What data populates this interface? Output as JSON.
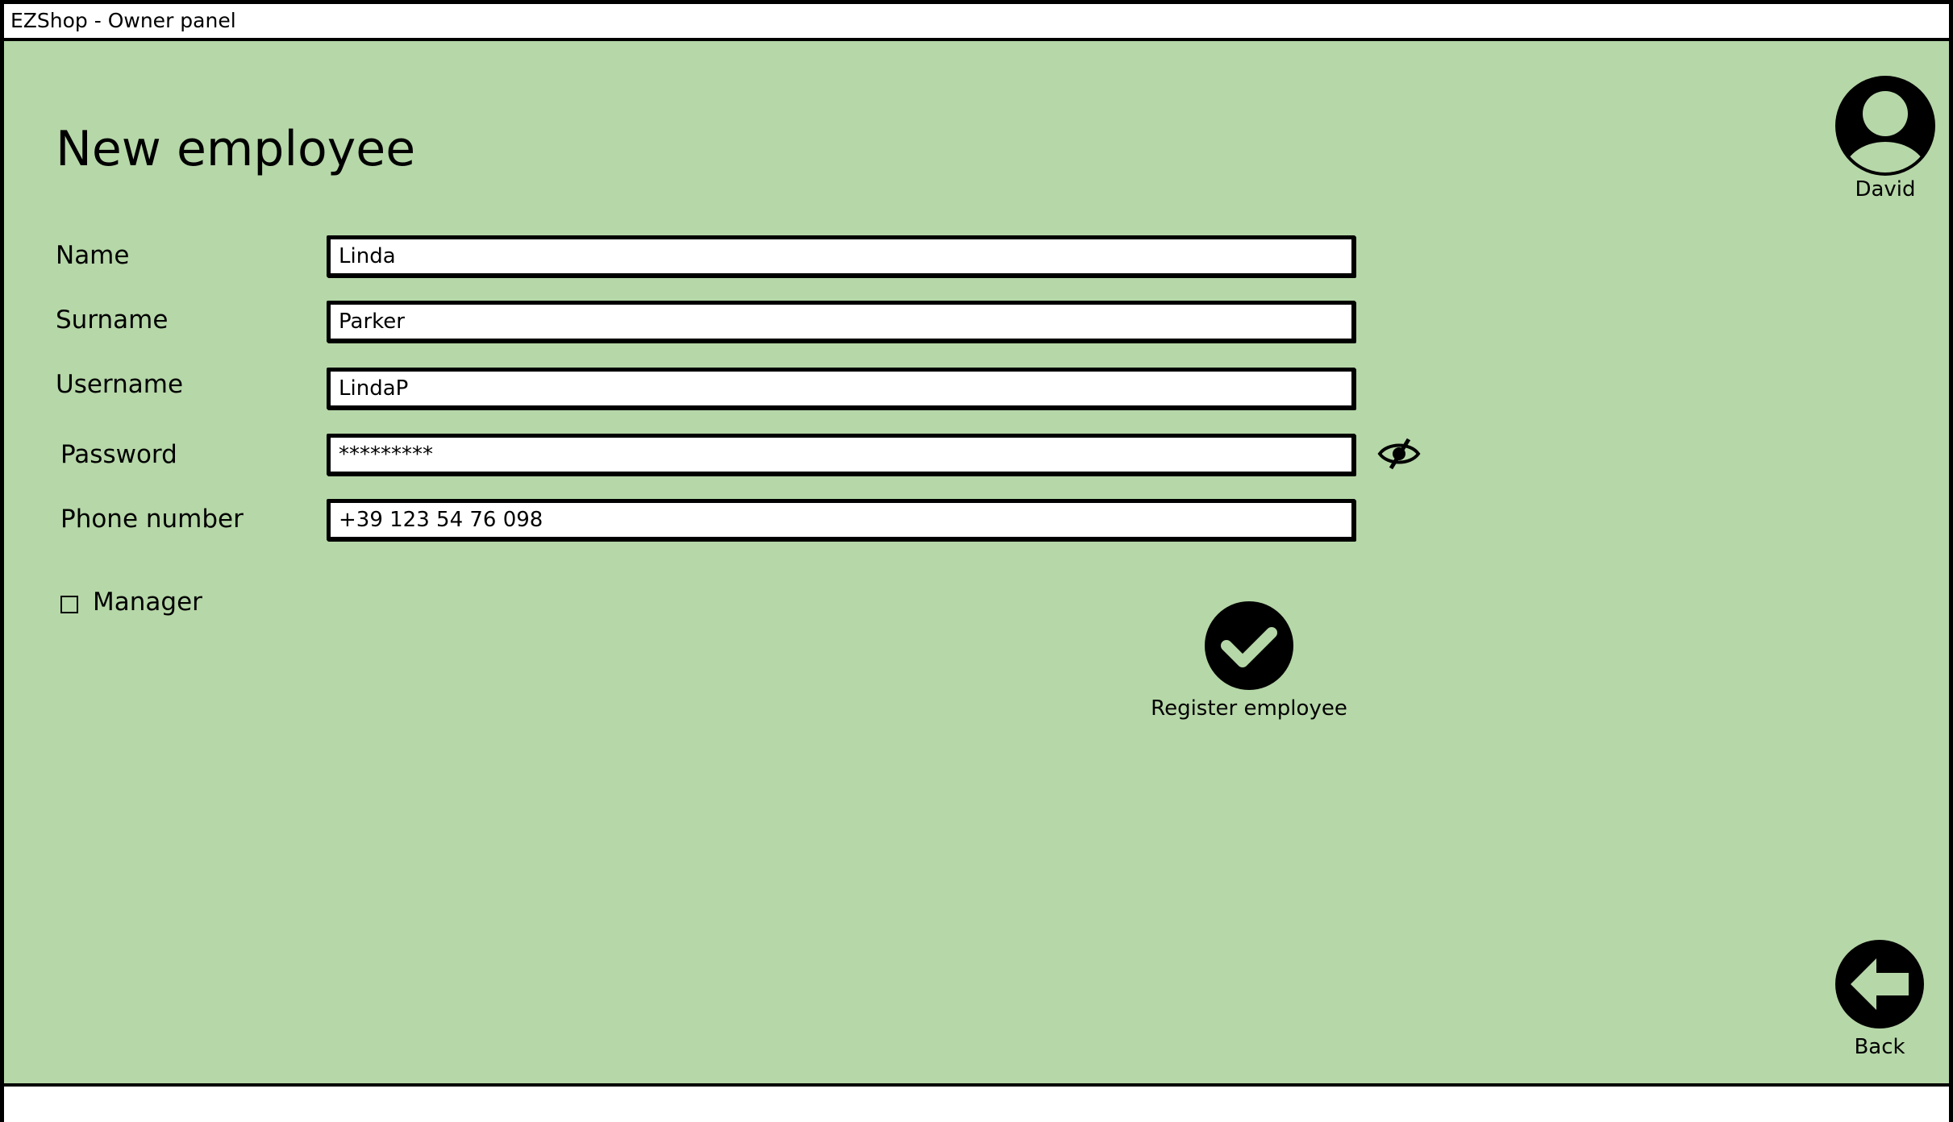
{
  "window": {
    "title": "EZShop - Owner panel"
  },
  "page": {
    "title": "New employee"
  },
  "user": {
    "name": "David"
  },
  "form": {
    "name": {
      "label": "Name",
      "value": "Linda"
    },
    "surname": {
      "label": "Surname",
      "value": "Parker"
    },
    "username": {
      "label": "Username",
      "value": "LindaP"
    },
    "password": {
      "label": "Password",
      "value": "*********"
    },
    "phone": {
      "label": "Phone number",
      "value": "+39 123 54 76 098"
    },
    "manager": {
      "label": "Manager",
      "checked": false
    }
  },
  "actions": {
    "register_label": "Register employee",
    "back_label": "Back"
  },
  "colors": {
    "background": "#b6d7a8",
    "icon": "#000000"
  },
  "icons": {
    "avatar": "user-avatar-icon",
    "password_toggle": "eye-slash-icon",
    "register": "checkmark-circle-icon",
    "back": "arrow-left-circle-icon"
  }
}
